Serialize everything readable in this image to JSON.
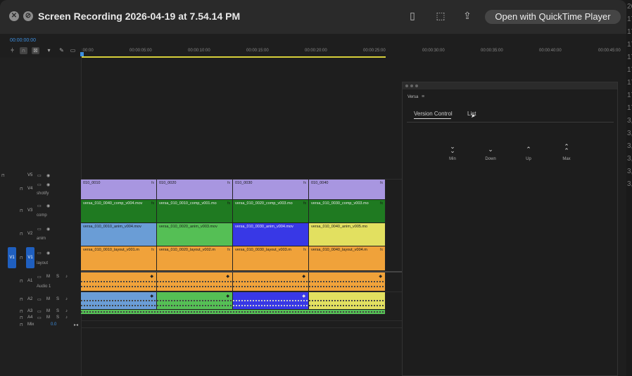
{
  "window": {
    "title": "Screen Recording 2026-04-19 at 7.54.14 PM",
    "open_button": "Open with QuickTime Player",
    "right_strip": [
      "26",
      "17",
      "17",
      "17",
      "17",
      "17",
      "17",
      "17",
      "17",
      "3,",
      "3,",
      "3,",
      "3,",
      "3,",
      "3,"
    ]
  },
  "timeline": {
    "timecode": "00:00:00:00",
    "ticks": [
      ":00:00",
      "00:00:05:00",
      "00:00:10:00",
      "00:00:15:00",
      "00:00:20:00",
      "00:00:25:00",
      "00:00:30:00",
      "00:00:35:00",
      "00:00:40:00",
      "00:00:45:00"
    ],
    "tracks": {
      "v5": {
        "label": "V5"
      },
      "v4": {
        "label": "V4",
        "name": "shotify"
      },
      "v3": {
        "label": "V3",
        "name": "comp"
      },
      "v2": {
        "label": "V2",
        "name": "anim"
      },
      "v1": {
        "label": "V1",
        "name": "layout",
        "source": "V1"
      },
      "a1": {
        "label": "A1",
        "name": "Audio 1",
        "m": "M",
        "s": "S"
      },
      "a2": {
        "label": "A2",
        "m": "M",
        "s": "S"
      },
      "a3": {
        "label": "A3",
        "m": "M",
        "s": "S"
      },
      "a4": {
        "label": "A4",
        "m": "M",
        "s": "S"
      },
      "mix": {
        "label": "Mix",
        "value": "0.0"
      }
    },
    "fx_label": "fx",
    "clips": {
      "v4": [
        "010_0010",
        "010_0020",
        "010_0030",
        "010_0040"
      ],
      "v3": [
        "versa_010_0040_comp_v004.mov",
        "versa_010_0010_comp_v001.mo",
        "versa_010_0020_comp_v003.mo",
        "versa_010_0030_comp_v003.mo"
      ],
      "v2": [
        "versa_010_0010_anim_v004.mov",
        "versa_010_0020_anim_v003.mov",
        "versa_010_0030_anim_v004.mov",
        "versa_010_0040_anim_v005.mo"
      ],
      "v1": [
        "versa_010_0010_layout_v001.m",
        "versa_010_0020_layout_v002.m",
        "versa_010_0030_layout_v003.m",
        "versa_010_0040_layout_v004.m"
      ]
    },
    "colors": {
      "v4": "#a896e0",
      "v3": "#1f7a21",
      "v2": [
        "#6a9dd6",
        "#55bf55",
        "#3838e6",
        "#e2e060"
      ],
      "v1": "#f0a23a",
      "a1": "#f0a23a",
      "a2": [
        "#6a9dd6",
        "#55bf55",
        "#3838e6",
        "#e2e060"
      ],
      "a3": "#55bf55"
    }
  },
  "panel": {
    "title": "Versa",
    "menu": "≡",
    "tabs": [
      "Version Control",
      "List"
    ],
    "buttons": [
      {
        "label": "Min",
        "icon": "double-chevron-down-icon"
      },
      {
        "label": "Down",
        "icon": "chevron-down-icon"
      },
      {
        "label": "Up",
        "icon": "chevron-up-icon"
      },
      {
        "label": "Max",
        "icon": "double-chevron-up-icon"
      }
    ]
  }
}
